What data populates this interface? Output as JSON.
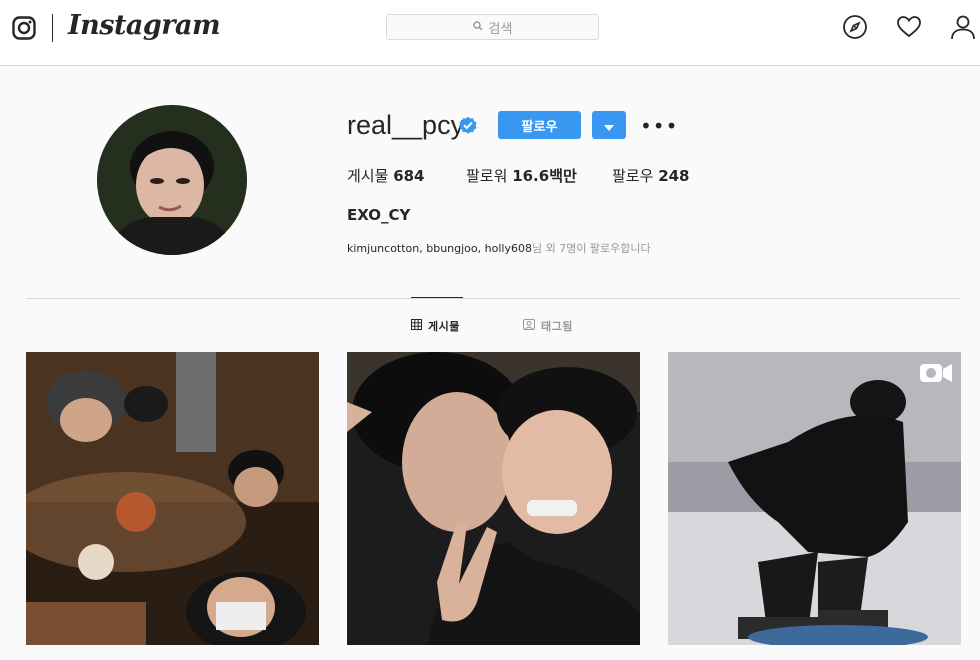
{
  "app": {
    "name": "Instagram"
  },
  "search": {
    "placeholder": "검색"
  },
  "profile": {
    "username": "real__pcy",
    "follow_label": "팔로우",
    "stats": [
      {
        "label": "게시물",
        "value": "684"
      },
      {
        "label": "팔로워",
        "value": "16.6백만"
      },
      {
        "label": "팔로우",
        "value": "248"
      }
    ],
    "full_name": "EXO_CY",
    "followed_by_names": "kimjuncotton, bbungjoo, holly608",
    "followed_by_suffix": "님 외 7명이 팔로우합니다"
  },
  "tabs": [
    {
      "label": "게시물",
      "icon": "grid-icon",
      "active": true
    },
    {
      "label": "태그됨",
      "icon": "tag-icon",
      "active": false
    }
  ],
  "colors": {
    "accent": "#3897f0",
    "verified": "#3897f0",
    "border": "#dbdbdb"
  },
  "posts": [
    {
      "type": "image",
      "icon": null
    },
    {
      "type": "image",
      "icon": null
    },
    {
      "type": "video",
      "icon": "video-icon"
    }
  ]
}
